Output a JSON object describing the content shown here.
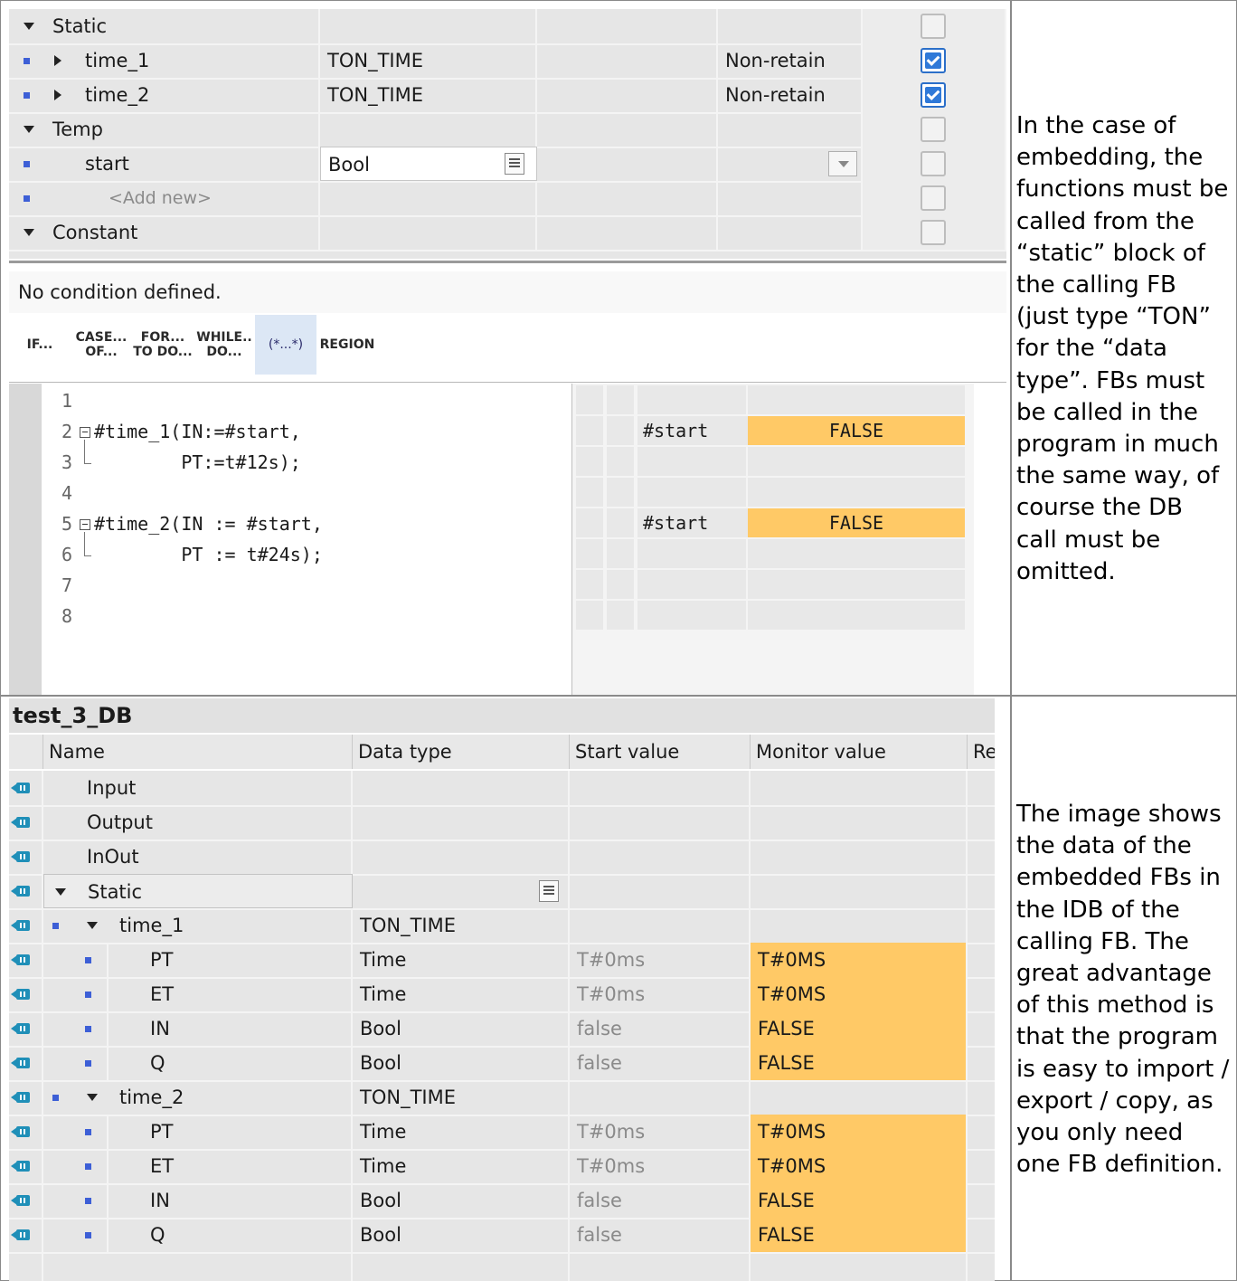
{
  "top_table": {
    "rows": [
      {
        "name": "Static",
        "type": "",
        "retain": ""
      },
      {
        "name": "time_1",
        "type": "TON_TIME",
        "retain": "Non-retain"
      },
      {
        "name": "time_2",
        "type": "TON_TIME",
        "retain": "Non-retain"
      },
      {
        "name": "Temp",
        "type": "",
        "retain": ""
      },
      {
        "name": "start",
        "type": "Bool",
        "retain": ""
      },
      {
        "name": "<Add new>",
        "type": "",
        "retain": ""
      },
      {
        "name": "Constant",
        "type": "",
        "retain": ""
      }
    ]
  },
  "condition_text": "No condition defined.",
  "toolbar": [
    {
      "l1": "IF...",
      "l2": ""
    },
    {
      "l1": "CASE...",
      "l2": "OF..."
    },
    {
      "l1": "FOR...",
      "l2": "TO DO..."
    },
    {
      "l1": "WHILE..",
      "l2": "DO..."
    },
    {
      "l1": "(*...*)",
      "l2": ""
    },
    {
      "l1": "REGION",
      "l2": ""
    }
  ],
  "code": {
    "line_numbers": [
      "1",
      "2",
      "3",
      "4",
      "5",
      "6",
      "7",
      "8"
    ],
    "lines": [
      "",
      "#time_1(IN:=#start,",
      "        PT:=t#12s);",
      "",
      "#time_2(IN := #start,",
      "        PT := t#24s);",
      "",
      ""
    ]
  },
  "monitor": {
    "var1": "#start",
    "val1": "FALSE",
    "var2": "#start",
    "val2": "FALSE"
  },
  "notes": {
    "top": "In the case of embedding, the functions must be called from the “static” block of the calling FB (just type “TON” for the “data type”. FBs must be called in the program in much the same way, of course the DB call must be omitted.",
    "bottom": "The image shows the data of the embedded FBs in the IDB of the calling FB. The great advantage of this method is that the program is easy to import / export / copy, as you only need one FB definition."
  },
  "db": {
    "title": "test_3_DB",
    "headers": [
      "Name",
      "Data type",
      "Start value",
      "Monitor value",
      "Re"
    ],
    "rows": [
      {
        "name": "Input",
        "type": "",
        "start": "",
        "monitor": ""
      },
      {
        "name": "Output",
        "type": "",
        "start": "",
        "monitor": ""
      },
      {
        "name": "InOut",
        "type": "",
        "start": "",
        "monitor": ""
      },
      {
        "name": "Static",
        "type": "",
        "start": "",
        "monitor": ""
      },
      {
        "name": "time_1",
        "type": "TON_TIME",
        "start": "",
        "monitor": ""
      },
      {
        "name": "PT",
        "type": "Time",
        "start": "T#0ms",
        "monitor": "T#0MS"
      },
      {
        "name": "ET",
        "type": "Time",
        "start": "T#0ms",
        "monitor": "T#0MS"
      },
      {
        "name": "IN",
        "type": "Bool",
        "start": "false",
        "monitor": "FALSE"
      },
      {
        "name": "Q",
        "type": "Bool",
        "start": "false",
        "monitor": "FALSE"
      },
      {
        "name": "time_2",
        "type": "TON_TIME",
        "start": "",
        "monitor": ""
      },
      {
        "name": "PT",
        "type": "Time",
        "start": "T#0ms",
        "monitor": "T#0MS"
      },
      {
        "name": "ET",
        "type": "Time",
        "start": "T#0ms",
        "monitor": "T#0MS"
      },
      {
        "name": "IN",
        "type": "Bool",
        "start": "false",
        "monitor": "FALSE"
      },
      {
        "name": "Q",
        "type": "Bool",
        "start": "false",
        "monitor": "FALSE"
      }
    ]
  },
  "colors": {
    "monitor_highlight": "#ffc966",
    "blue_marker": "#3d5fd6",
    "db_icon": "#1f8fb8"
  }
}
